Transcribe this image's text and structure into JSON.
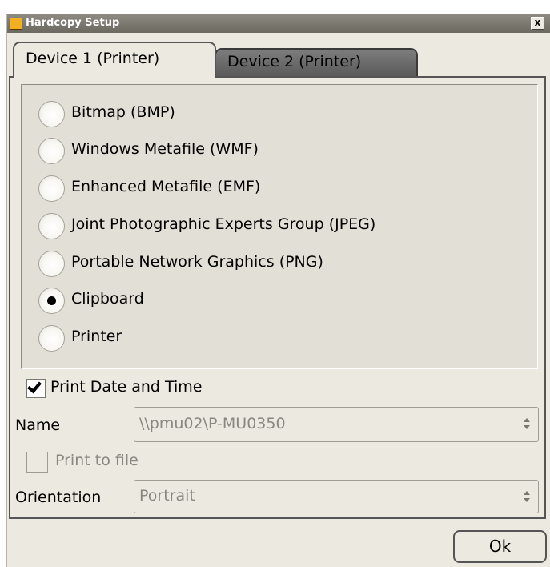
{
  "window": {
    "title": "Hardcopy Setup",
    "close_glyph": "x",
    "app_icon": "oscilloscope-icon"
  },
  "tabs": [
    {
      "label": "Device 1 (Printer)",
      "active": true
    },
    {
      "label": "Device 2 (Printer)",
      "active": false
    }
  ],
  "formats": [
    {
      "label": "Bitmap (BMP)",
      "selected": false
    },
    {
      "label": "Windows Metafile (WMF)",
      "selected": false
    },
    {
      "label": "Enhanced Metafile (EMF)",
      "selected": false
    },
    {
      "label": "Joint Photographic Experts Group (JPEG)",
      "selected": false
    },
    {
      "label": "Portable Network Graphics (PNG)",
      "selected": false
    },
    {
      "label": "Clipboard",
      "selected": true
    },
    {
      "label": "Printer",
      "selected": false
    }
  ],
  "print_date_time": {
    "label": "Print Date and Time",
    "checked": true
  },
  "name": {
    "label": "Name",
    "value": "\\\\pmu02\\P-MU0350"
  },
  "print_to_file": {
    "label": "Print to file",
    "checked": false,
    "enabled": false
  },
  "orientation": {
    "label": "Orientation",
    "value": "Portrait"
  },
  "ok_label": "Ok"
}
